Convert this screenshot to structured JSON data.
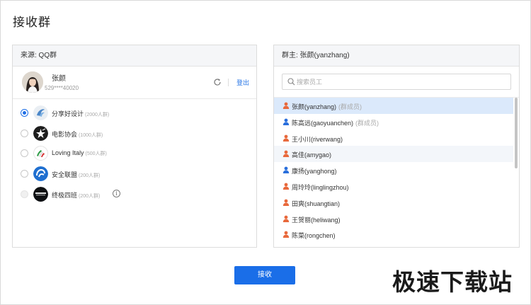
{
  "page": {
    "title": "接收群"
  },
  "left_panel": {
    "header": "来源: QQ群",
    "account": {
      "name": "张颜",
      "id": "529****40020",
      "logout_label": "登出"
    },
    "groups": [
      {
        "name": "分享好设计",
        "count": "(2000人群)",
        "selected": true,
        "disabled": false
      },
      {
        "name": "电影协会",
        "count": "(1000人群)",
        "selected": false,
        "disabled": false
      },
      {
        "name": "Loving Italy",
        "count": "(500人群)",
        "selected": false,
        "disabled": false
      },
      {
        "name": "安全联盟",
        "count": "(200人群)",
        "selected": false,
        "disabled": false
      },
      {
        "name": "终极四班",
        "count": "(200人群)",
        "selected": false,
        "disabled": true,
        "info_glyph": "i"
      }
    ]
  },
  "right_panel": {
    "header": "群主: 张颜(yanzhang)",
    "search": {
      "placeholder": "搜索员工",
      "value": ""
    },
    "members": [
      {
        "name": "张颜(yanzhang)",
        "tag": "(群成员)",
        "gender": "female",
        "state": "selected"
      },
      {
        "name": "陈高远(gaoyuanchen)",
        "tag": "(群成员)",
        "gender": "male",
        "state": ""
      },
      {
        "name": "王小川(riverwang)",
        "tag": "",
        "gender": "female",
        "state": ""
      },
      {
        "name": "高佳(amygao)",
        "tag": "",
        "gender": "female",
        "state": "hover"
      },
      {
        "name": "康扬(yanghong)",
        "tag": "",
        "gender": "male",
        "state": ""
      },
      {
        "name": "周玲玲(linglingzhou)",
        "tag": "",
        "gender": "female",
        "state": ""
      },
      {
        "name": "田爽(shuangtian)",
        "tag": "",
        "gender": "female",
        "state": ""
      },
      {
        "name": "王贺丽(heliwang)",
        "tag": "",
        "gender": "female",
        "state": ""
      },
      {
        "name": "陈菜(rongchen)",
        "tag": "",
        "gender": "female",
        "state": ""
      }
    ]
  },
  "actions": {
    "receive_label": "接收"
  },
  "watermark": {
    "text": "极速下载站"
  },
  "colors": {
    "accent": "#1a6ee8",
    "female_icon": "#e8693c",
    "male_icon": "#2a6fdc",
    "selected_row": "#dbe9fb"
  }
}
